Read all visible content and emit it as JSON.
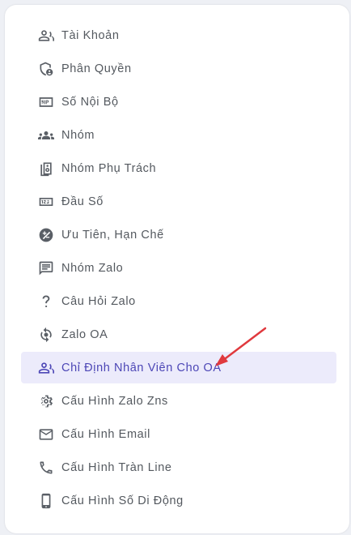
{
  "menu": {
    "items": [
      {
        "label": "Tài Khoản",
        "icon": "users-icon"
      },
      {
        "label": "Phân Quyền",
        "icon": "shield-user-icon"
      },
      {
        "label": "Số Nội Bộ",
        "icon": "sip-icon"
      },
      {
        "label": "Nhóm",
        "icon": "group-icon"
      },
      {
        "label": "Nhóm Phụ Trách",
        "icon": "speaker-icon"
      },
      {
        "label": "Đầu Số",
        "icon": "number-123-icon"
      },
      {
        "label": "Ưu Tiên, Hạn Chế",
        "icon": "priority-icon"
      },
      {
        "label": "Nhóm Zalo",
        "icon": "chat-icon"
      },
      {
        "label": "Câu Hỏi Zalo",
        "icon": "question-icon"
      },
      {
        "label": "Zalo OA",
        "icon": "sync-icon"
      },
      {
        "label": "Chỉ Định Nhân Viên Cho OA",
        "icon": "users-icon",
        "active": true
      },
      {
        "label": "Cấu Hình Zalo Zns",
        "icon": "gear-icon"
      },
      {
        "label": "Cấu Hình Email",
        "icon": "mail-icon"
      },
      {
        "label": "Cấu Hình Tràn Line",
        "icon": "phone-icon"
      },
      {
        "label": "Cấu Hình Số Di Động",
        "icon": "mobile-icon"
      }
    ]
  },
  "colors": {
    "active_bg": "#ecebfb",
    "active_text": "#4c46b6",
    "text": "#54595f",
    "arrow": "#e0393e"
  }
}
